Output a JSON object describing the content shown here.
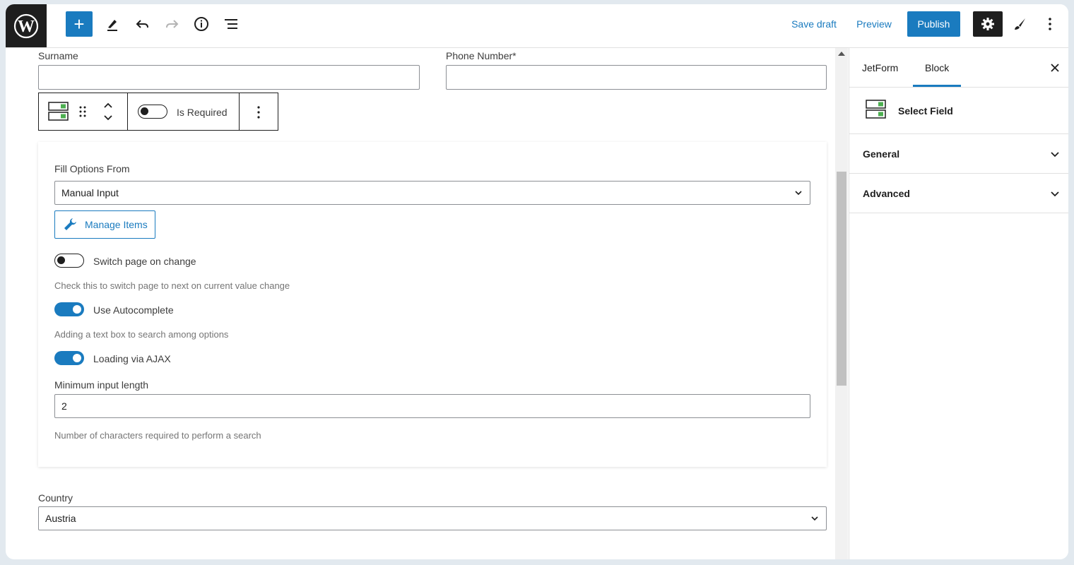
{
  "toolbar": {
    "save_draft": "Save draft",
    "preview": "Preview",
    "publish": "Publish",
    "icons": [
      "wordpress-logo-icon",
      "plus-icon",
      "pencil-icon",
      "undo-icon",
      "redo-icon",
      "info-icon",
      "list-view-icon",
      "gear-icon",
      "brush-icon",
      "more-vertical-icon"
    ]
  },
  "form": {
    "surname_label": "Surname",
    "surname_value": "",
    "phone_label": "Phone Number*",
    "phone_value": "",
    "country_label": "Country",
    "country_value": "Austria"
  },
  "block_toolbar": {
    "required_label": "Is Required",
    "required_on": false
  },
  "panel": {
    "fill_label": "Fill Options From",
    "fill_value": "Manual Input",
    "manage_items": "Manage Items",
    "switch_page_label": "Switch page on change",
    "switch_page_on": false,
    "switch_page_help": "Check this to switch page to next on current value change",
    "autocomplete_label": "Use Autocomplete",
    "autocomplete_on": true,
    "autocomplete_help": "Adding a text box to search among options",
    "ajax_label": "Loading via AJAX",
    "ajax_on": true,
    "min_length_label": "Minimum input length",
    "min_length_value": "2",
    "min_length_help": "Number of characters required to perform a search"
  },
  "sidebar": {
    "tabs": [
      {
        "label": "JetForm",
        "active": false
      },
      {
        "label": "Block",
        "active": true
      }
    ],
    "block_name": "Select Field",
    "sections": [
      "General",
      "Advanced"
    ]
  },
  "colors": {
    "accent": "#1a7bbf",
    "dark": "#1e1e1e",
    "icon_green": "#4caf50"
  }
}
